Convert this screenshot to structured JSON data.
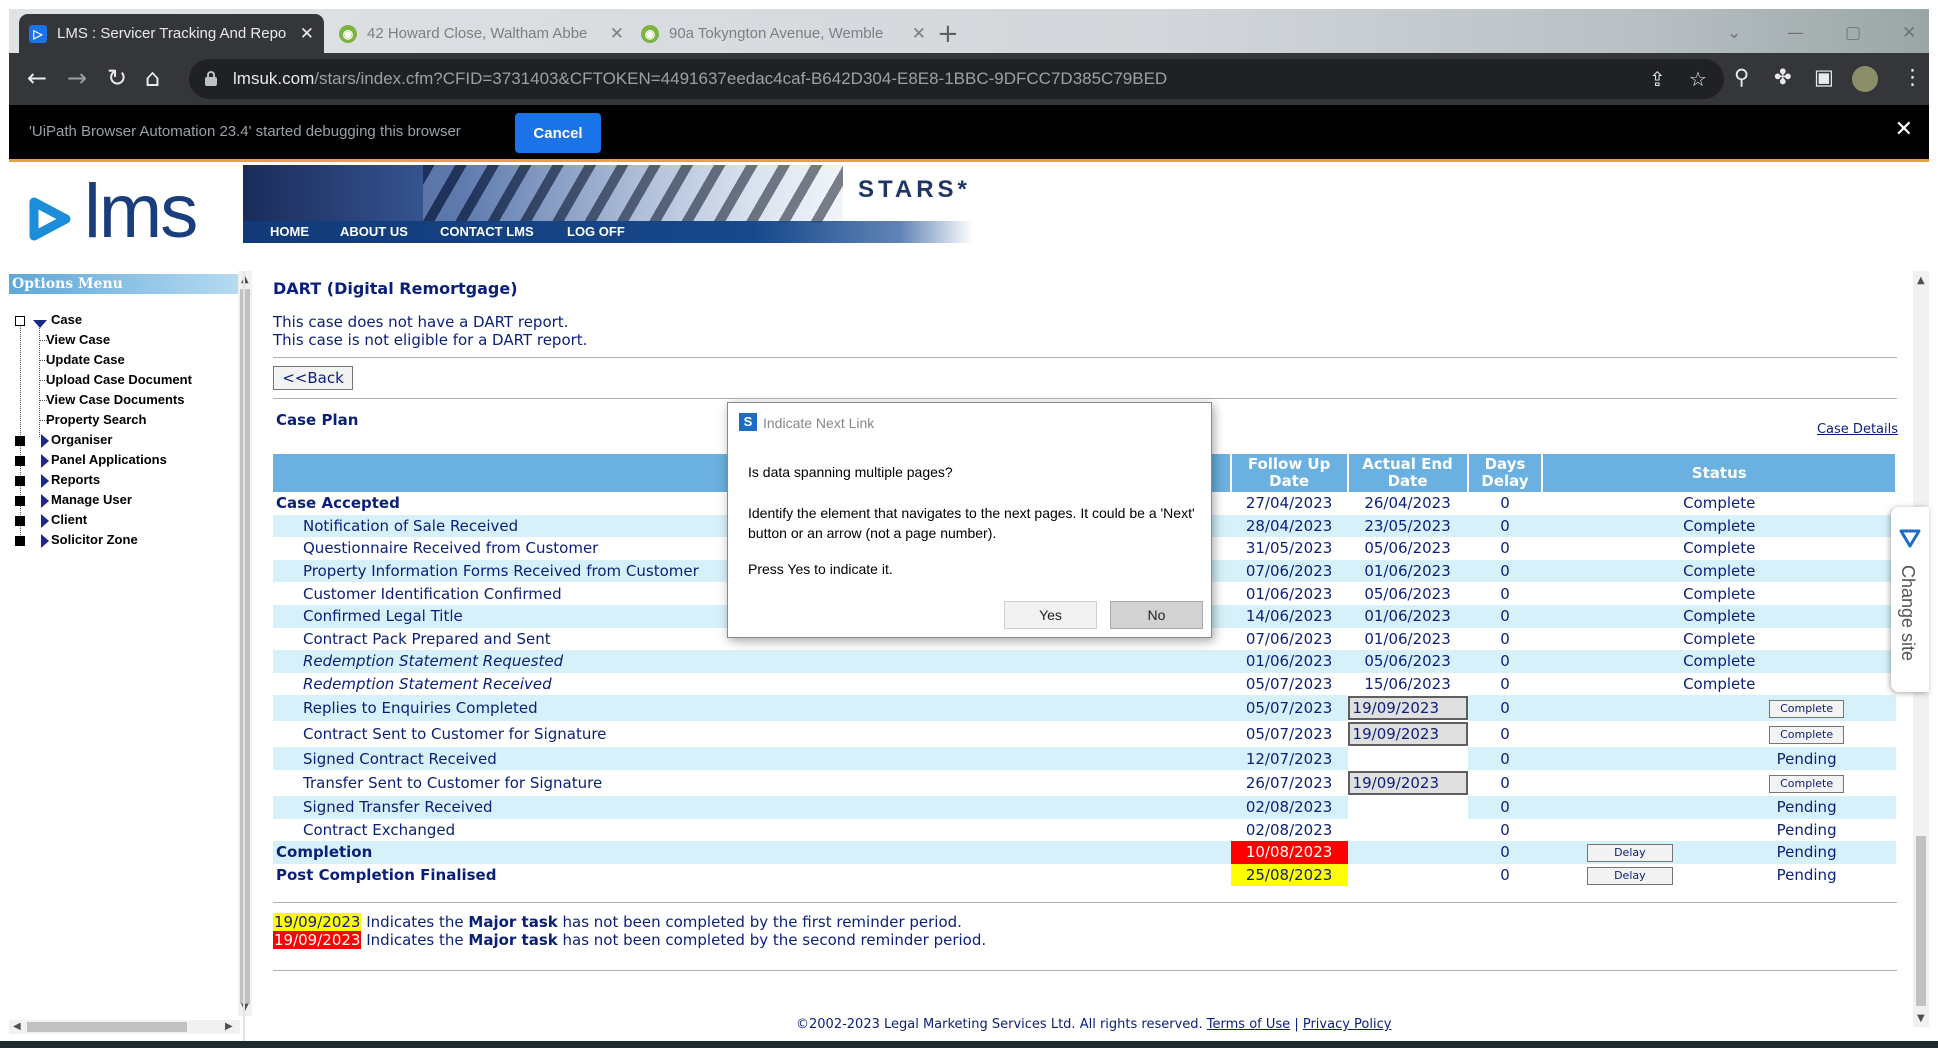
{
  "browser": {
    "tabs": [
      {
        "label": "LMS : Servicer Tracking And Repo",
        "active": true
      },
      {
        "label": "42 Howard Close, Waltham Abbe",
        "active": false
      },
      {
        "label": "90a Tokyngton Avenue, Wemble",
        "active": false
      }
    ],
    "url_host": "lmsuk.com",
    "url_path": "/stars/index.cfm?CFID=3731403&CFTOKEN=4491637eedac4caf-B642D304-E8E8-1BBC-9DFCC7D385C79BED",
    "debug_message": "'UiPath Browser Automation 23.4' started debugging this browser",
    "debug_cancel": "Cancel"
  },
  "site": {
    "logo_text": "lms",
    "product_name": "STARS*",
    "nav": [
      "HOME",
      "ABOUT US",
      "CONTACT LMS",
      "LOG OFF"
    ]
  },
  "options_menu": {
    "title": "Options Menu",
    "case_label": "Case",
    "case_children": [
      "View Case",
      "Update Case",
      "Upload Case Document",
      "View Case Documents",
      "Property Search"
    ],
    "sections": [
      "Organiser",
      "Panel Applications",
      "Reports",
      "Manage User",
      "Client",
      "Solicitor Zone"
    ]
  },
  "main": {
    "title": "DART (Digital Remortgage)",
    "info1": "This case does not have a DART report.",
    "info2": "This case is not eligible for a DART report.",
    "back": "<<Back",
    "case_plan": "Case Plan",
    "case_details": "Case Details",
    "headers": {
      "follow_up": "Follow Up Date",
      "actual_end": "Actual End Date",
      "days_delay": "Days Delay",
      "status": "Status"
    },
    "rows": [
      {
        "name": "Case Accepted",
        "follow": "27/04/2023",
        "actual": "26/04/2023",
        "days": "0",
        "status": "Complete"
      },
      {
        "name": "Notification of Sale Received",
        "follow": "28/04/2023",
        "actual": "23/05/2023",
        "days": "0",
        "status": "Complete"
      },
      {
        "name": "Questionnaire Received from Customer",
        "follow": "31/05/2023",
        "actual": "05/06/2023",
        "days": "0",
        "status": "Complete"
      },
      {
        "name": "Property Information Forms Received from Customer",
        "follow": "07/06/2023",
        "actual": "01/06/2023",
        "days": "0",
        "status": "Complete"
      },
      {
        "name": "Customer Identification Confirmed",
        "follow": "01/06/2023",
        "actual": "05/06/2023",
        "days": "0",
        "status": "Complete"
      },
      {
        "name": "Confirmed Legal Title",
        "follow": "14/06/2023",
        "actual": "01/06/2023",
        "days": "0",
        "status": "Complete"
      },
      {
        "name": "Contract Pack Prepared and Sent",
        "follow": "07/06/2023",
        "actual": "01/06/2023",
        "days": "0",
        "status": "Complete"
      },
      {
        "name": "Redemption Statement Requested",
        "follow": "01/06/2023",
        "actual": "05/06/2023",
        "days": "0",
        "status": "Complete"
      },
      {
        "name": "Redemption Statement Received",
        "follow": "05/07/2023",
        "actual": "15/06/2023",
        "days": "0",
        "status": "Complete"
      },
      {
        "name": "Replies to Enquiries Completed",
        "follow": "05/07/2023",
        "actual_input": "19/09/2023",
        "days": "0",
        "button": "Complete"
      },
      {
        "name": "Contract Sent to Customer for Signature",
        "follow": "05/07/2023",
        "actual_input": "19/09/2023",
        "days": "0",
        "button": "Complete"
      },
      {
        "name": "Signed Contract Received",
        "follow": "12/07/2023",
        "days": "0",
        "status": "Pending"
      },
      {
        "name": "Transfer Sent to Customer for Signature",
        "follow": "26/07/2023",
        "actual_input": "19/09/2023",
        "days": "0",
        "button": "Complete"
      },
      {
        "name": "Signed Transfer Received",
        "follow": "02/08/2023",
        "days": "0",
        "status": "Pending"
      },
      {
        "name": "Contract Exchanged",
        "follow": "02/08/2023",
        "days": "0",
        "status": "Pending"
      },
      {
        "name": "Completion",
        "follow": "10/08/2023",
        "days": "0",
        "delay": "Delay",
        "status": "Pending"
      },
      {
        "name": "Post Completion Finalised",
        "follow": "25/08/2023",
        "days": "0",
        "delay": "Delay",
        "status": "Pending"
      }
    ],
    "legend": [
      {
        "date": "19/09/2023",
        "pre": "Indicates the",
        "bold": "Major task",
        "post": "has not been completed by the first reminder period."
      },
      {
        "date": "19/09/2023",
        "pre": "Indicates the",
        "bold": "Major task",
        "post": "has not been completed by the second reminder period."
      }
    ],
    "footer": {
      "copyright": "©2002-2023 Legal Marketing Services Ltd. All rights reserved.",
      "terms": "Terms of Use",
      "sep": "|",
      "privacy": "Privacy Policy"
    }
  },
  "change_site": "Change site",
  "dialog": {
    "title": "Indicate Next Link",
    "question": "Is data spanning multiple pages?",
    "body": "Identify the element that navigates to the next pages. It could be a 'Next' button or an arrow (not a page number).",
    "prompt": "Press Yes to indicate it.",
    "yes": "Yes",
    "no": "No"
  }
}
